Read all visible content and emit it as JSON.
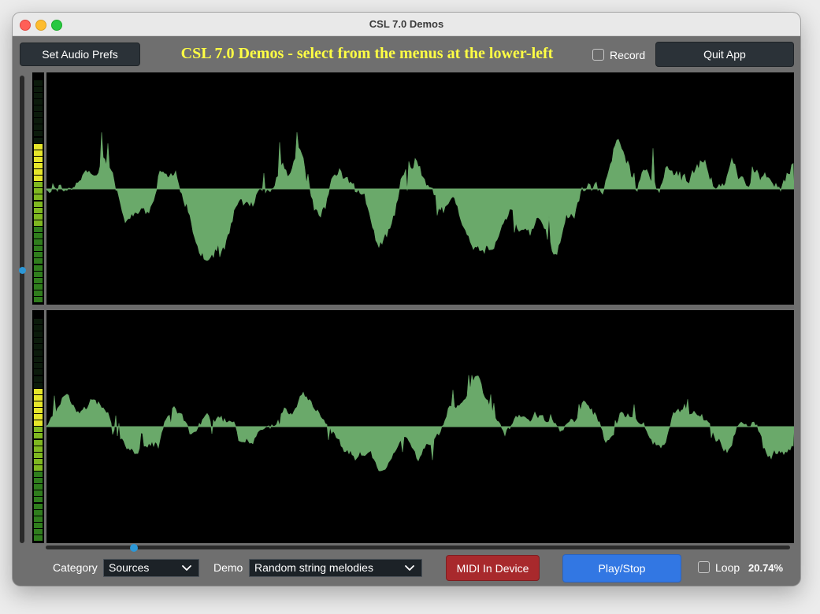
{
  "window": {
    "title": "CSL 7.0 Demos"
  },
  "header": {
    "audio_prefs_label": "Set Audio Prefs",
    "headline": "CSL 7.0 Demos - select from the menus at the lower-left",
    "record_label": "Record",
    "record_checked": false,
    "quit_label": "Quit App"
  },
  "waveform": {
    "color": "#6aa96a",
    "background": "#000000"
  },
  "footer": {
    "category_label": "Category",
    "category_value": "Sources",
    "demo_label": "Demo",
    "demo_value": "Random string melodies",
    "midi_label": "MIDI In Device",
    "play_label": "Play/Stop",
    "loop_label": "Loop",
    "loop_checked": false,
    "cpu_percent": "20.74%"
  },
  "colors": {
    "headline": "#ffff44",
    "midi_button": "#a8292c",
    "play_button": "#3277e3",
    "slider_thumb": "#2c97d6"
  }
}
